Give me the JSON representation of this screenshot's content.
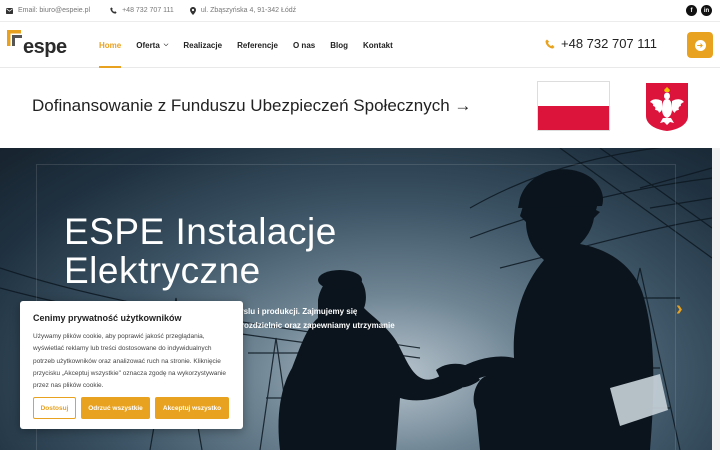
{
  "topbar": {
    "email": "Email: biuro@espeie.pl",
    "phone": "+48 732 707 111",
    "address": "ul. Zbąszyńska 4, 91-342 Łódź",
    "socials": [
      {
        "icon": "facebook-icon",
        "glyph": "f"
      },
      {
        "icon": "linkedin-icon",
        "glyph": "in"
      }
    ]
  },
  "logo": {
    "text": "espe"
  },
  "nav": {
    "items": [
      {
        "label": "Home",
        "active": true
      },
      {
        "label": "Oferta",
        "dropdown": true
      },
      {
        "label": "Realizacje"
      },
      {
        "label": "Referencje"
      },
      {
        "label": "O nas"
      },
      {
        "label": "Blog"
      },
      {
        "label": "Kontakt"
      }
    ]
  },
  "header": {
    "phone": "+48 732 707 111",
    "cta_icon": "arrow-right-circle-icon"
  },
  "funding": {
    "text": "Dofinansowanie z Funduszu Ubezpieczeń Społecznych →"
  },
  "hero": {
    "title_line1": "ESPE Instalacje",
    "title_line2": "Elektryczne",
    "desc_line1": "myslu i produkcji. Zajmujemy się",
    "desc_line2": "ją rozdzielnic oraz zapewniamy utrzymanie"
  },
  "cookie": {
    "title": "Cenimy prywatność użytkowników",
    "body": "Używamy plików cookie, aby poprawić jakość przeglądania, wyświetlać reklamy lub treści dostosowane do indywidualnych potrzeb użytkowników oraz analizować ruch na stronie. Kliknięcie przycisku „Akceptuj wszystkie\" oznacza zgodę na wykorzystywanie przez nas plików cookie.",
    "customize_label": "Dostosuj",
    "reject_label": "Odrzuć wszystkie",
    "accept_label": "Akceptuj wszystko"
  },
  "colors": {
    "accent": "#e9a21f",
    "flag_red": "#dc143c"
  }
}
